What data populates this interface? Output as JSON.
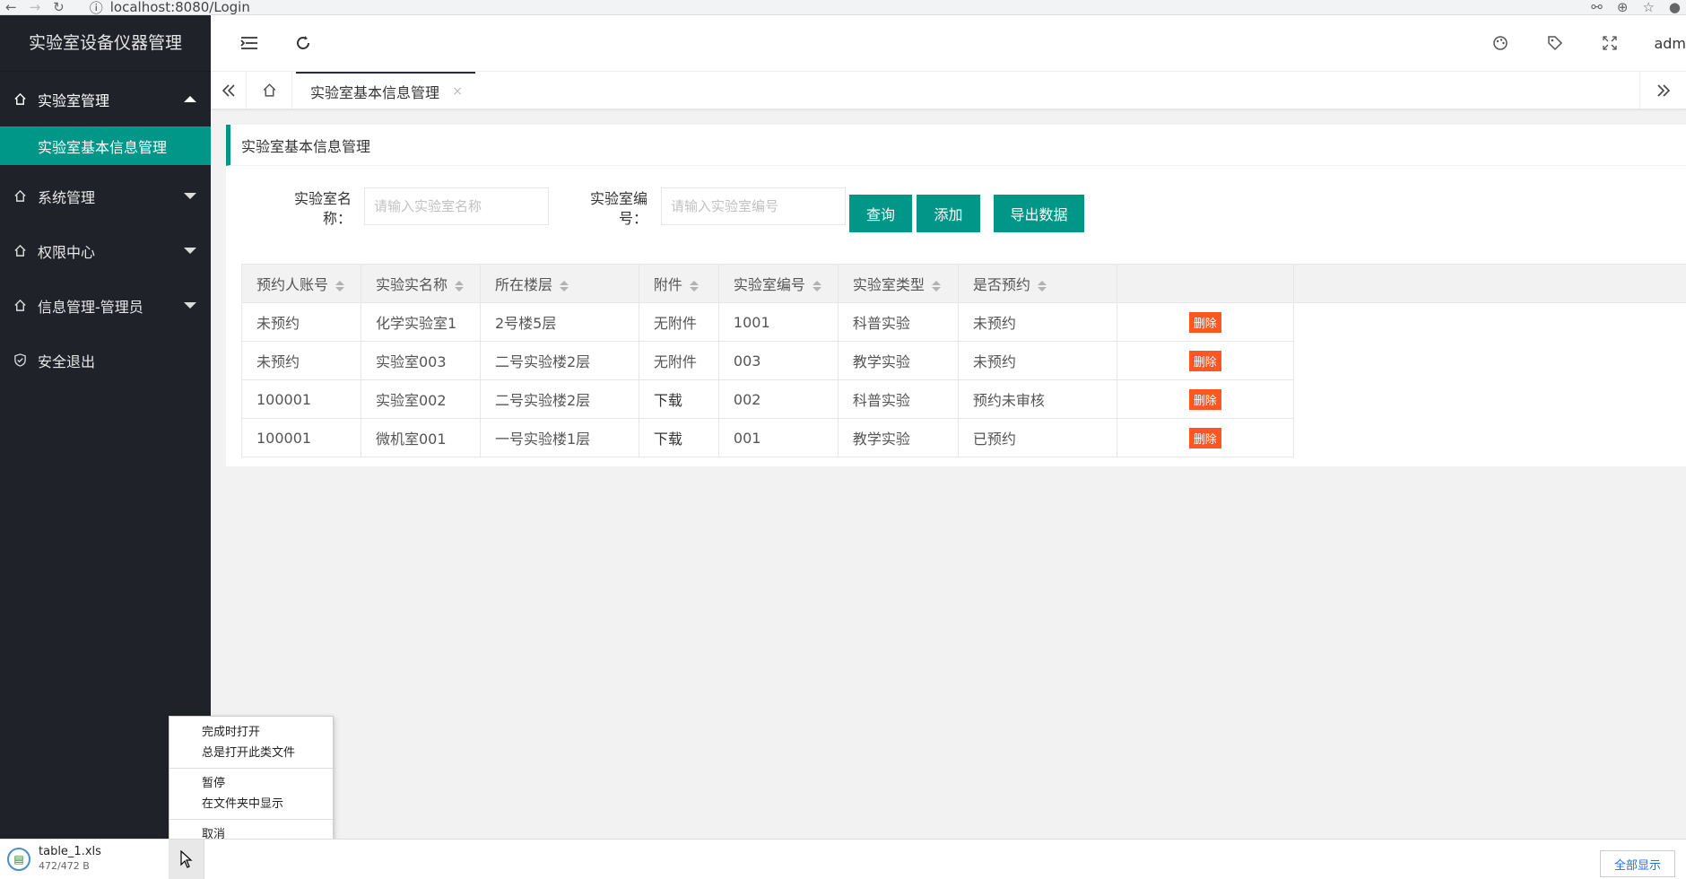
{
  "browser": {
    "url": "localhost:8080/Login"
  },
  "sidebar": {
    "title": "实验室设备仪器管理",
    "items": [
      {
        "label": "实验室管理",
        "expanded": true
      },
      {
        "label": "系统管理"
      },
      {
        "label": "权限中心"
      },
      {
        "label": "信息管理-管理员"
      },
      {
        "label": "安全退出"
      }
    ],
    "sub_active": "实验室基本信息管理"
  },
  "header": {
    "user": "adm"
  },
  "tabs": {
    "active": "实验室基本信息管理",
    "close": "×"
  },
  "card": {
    "title": "实验室基本信息管理",
    "form": {
      "name_label": "实验室名称：",
      "name_placeholder": "请输入实验室名称",
      "code_label": "实验室编号：",
      "code_placeholder": "请输入实验室编号",
      "query": "查询",
      "add": "添加",
      "export": "导出数据"
    },
    "table": {
      "headers": [
        "预约人账号",
        "实验实名称",
        "所在楼层",
        "附件",
        "实验室编号",
        "实验室类型",
        "是否预约"
      ],
      "delete_label": "删除",
      "rows": [
        [
          "未预约",
          "化学实验室1",
          "2号楼5层",
          "无附件",
          "1001",
          "科普实验",
          "未预约"
        ],
        [
          "未预约",
          "实验室003",
          "二号实验楼2层",
          "无附件",
          "003",
          "教学实验",
          "未预约"
        ],
        [
          "100001",
          "实验室002",
          "二号实验楼2层",
          "下载",
          "002",
          "科普实验",
          "预约未审核"
        ],
        [
          "100001",
          "微机室001",
          "一号实验楼1层",
          "下载",
          "001",
          "教学实验",
          "已预约"
        ]
      ]
    }
  },
  "context_menu": {
    "items": [
      "完成时打开",
      "总是打开此类文件",
      "暂停",
      "在文件夹中显示",
      "取消"
    ]
  },
  "download": {
    "filename": "table_1.xls",
    "size": "472/472 B",
    "show_all": "全部显示"
  },
  "colors": {
    "sidebar_bg": "#20222a",
    "accent": "#009688",
    "danger": "#ff5722"
  }
}
